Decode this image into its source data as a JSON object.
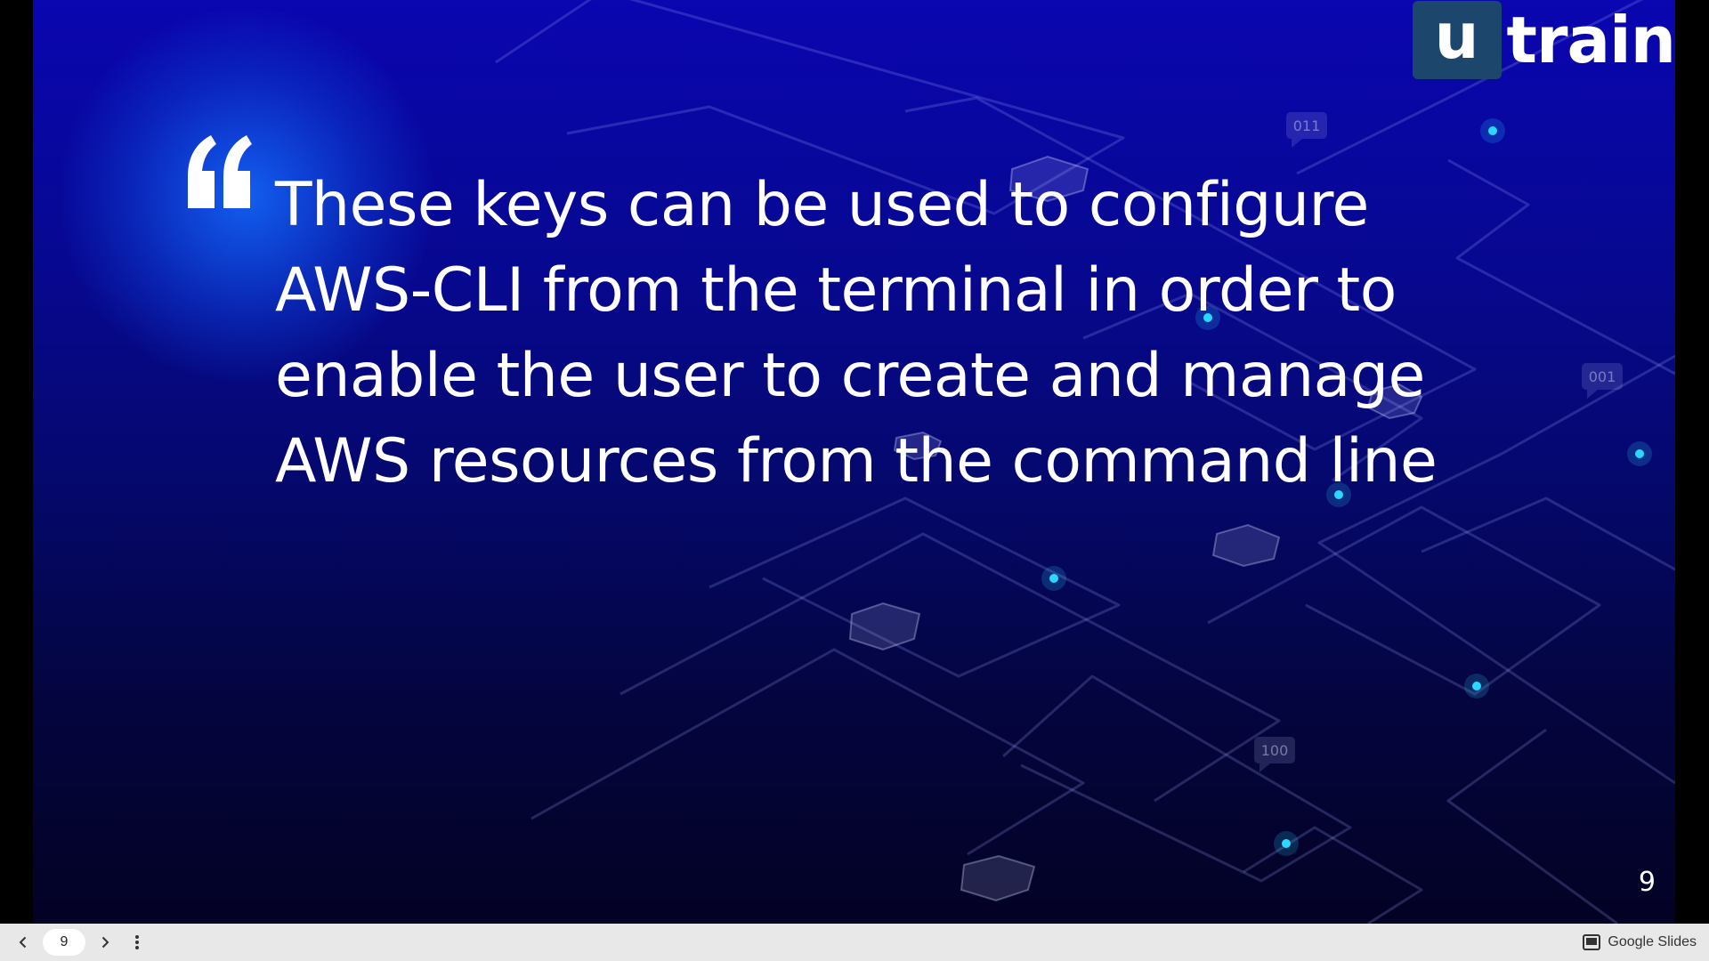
{
  "slide": {
    "logo": {
      "letter": "u",
      "word": "train"
    },
    "quote_text": "These keys can be used to configure AWS-CLI from the terminal in order to enable the user to create and manage AWS resources from the command line",
    "slide_number": "9",
    "binary_tags": [
      "011",
      "001",
      "100"
    ],
    "accent_color": "#2ad8ff"
  },
  "controls": {
    "page_input_value": "9",
    "prev_icon": "chevron-left-icon",
    "next_icon": "chevron-right-icon",
    "menu_icon": "more-vert-icon",
    "brand_label": "Google Slides",
    "brand_icon": "slides-icon"
  }
}
